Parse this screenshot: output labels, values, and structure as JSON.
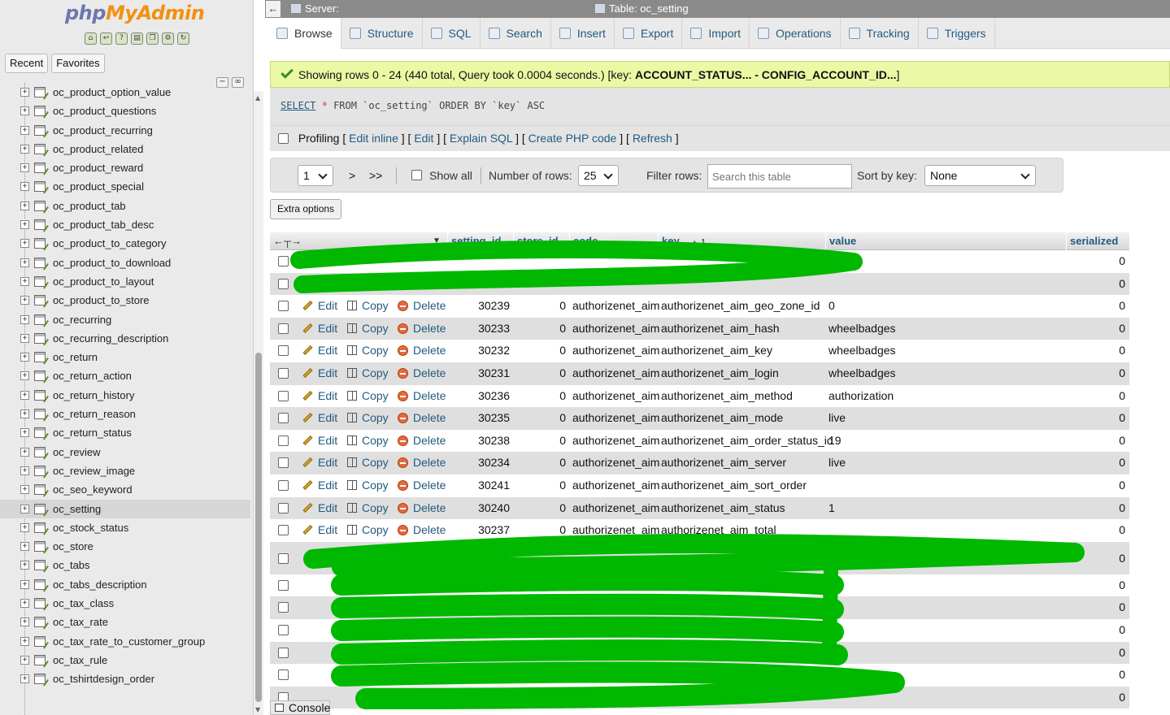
{
  "nav": {
    "logo_php": "php",
    "logo_myadmin": "MyAdmin",
    "recent_label": "Recent",
    "favorites_label": "Favorites",
    "tables": [
      "oc_product_option_value",
      "oc_product_questions",
      "oc_product_recurring",
      "oc_product_related",
      "oc_product_reward",
      "oc_product_special",
      "oc_product_tab",
      "oc_product_tab_desc",
      "oc_product_to_category",
      "oc_product_to_download",
      "oc_product_to_layout",
      "oc_product_to_store",
      "oc_recurring",
      "oc_recurring_description",
      "oc_return",
      "oc_return_action",
      "oc_return_history",
      "oc_return_reason",
      "oc_return_status",
      "oc_review",
      "oc_review_image",
      "oc_seo_keyword",
      "oc_setting",
      "oc_stock_status",
      "oc_store",
      "oc_tabs",
      "oc_tabs_description",
      "oc_tax_class",
      "oc_tax_rate",
      "oc_tax_rate_to_customer_group",
      "oc_tax_rule",
      "oc_tshirtdesign_order"
    ],
    "active_table": "oc_setting"
  },
  "topbar": {
    "server_label": "Server:",
    "table_label": "Table: oc_setting"
  },
  "tabs": [
    "Browse",
    "Structure",
    "SQL",
    "Search",
    "Insert",
    "Export",
    "Import",
    "Operations",
    "Tracking",
    "Triggers"
  ],
  "success": {
    "message_prefix": "Showing rows 0 - 24 (440 total, Query took 0.0004 seconds.) [key: ",
    "key_range": "ACCOUNT_STATUS... - CONFIG_ACCOUNT_ID...",
    "message_suffix": "]"
  },
  "sql": {
    "select": "SELECT",
    "star": "*",
    "rest": "FROM `oc_setting` ORDER BY `key` ASC"
  },
  "profiling": {
    "label": "Profiling",
    "links": [
      "Edit inline",
      "Edit",
      "Explain SQL",
      "Create PHP code",
      "Refresh"
    ]
  },
  "pager": {
    "page": "1",
    "next": ">",
    "last": ">>",
    "show_all": "Show all",
    "rows_label": "Number of rows:",
    "rows_value": "25",
    "filter_label": "Filter rows:",
    "filter_placeholder": "Search this table",
    "sort_label": "Sort by key:",
    "sort_value": "None"
  },
  "extra_options": "Extra options",
  "table": {
    "columns": [
      "setting_id",
      "store_id",
      "code",
      "key",
      "value",
      "serialized"
    ],
    "key_sort_marker": "1",
    "actions": {
      "edit": "Edit",
      "copy": "Copy",
      "delete": "Delete"
    },
    "rows": [
      {
        "setting_id": "",
        "store_id": "",
        "code": "",
        "key": "",
        "value": "",
        "serialized": "0",
        "redacted": true
      },
      {
        "setting_id": "",
        "store_id": "",
        "code": "",
        "key": "",
        "value": "",
        "serialized": "0",
        "redacted": true
      },
      {
        "setting_id": "30239",
        "store_id": "0",
        "code": "authorizenet_aim",
        "key": "authorizenet_aim_geo_zone_id",
        "value": "0",
        "serialized": "0"
      },
      {
        "setting_id": "30233",
        "store_id": "0",
        "code": "authorizenet_aim",
        "key": "authorizenet_aim_hash",
        "value": "wheelbadges",
        "serialized": "0"
      },
      {
        "setting_id": "30232",
        "store_id": "0",
        "code": "authorizenet_aim",
        "key": "authorizenet_aim_key",
        "value": "wheelbadges",
        "serialized": "0"
      },
      {
        "setting_id": "30231",
        "store_id": "0",
        "code": "authorizenet_aim",
        "key": "authorizenet_aim_login",
        "value": "wheelbadges",
        "serialized": "0"
      },
      {
        "setting_id": "30236",
        "store_id": "0",
        "code": "authorizenet_aim",
        "key": "authorizenet_aim_method",
        "value": "authorization",
        "serialized": "0"
      },
      {
        "setting_id": "30235",
        "store_id": "0",
        "code": "authorizenet_aim",
        "key": "authorizenet_aim_mode",
        "value": "live",
        "serialized": "0"
      },
      {
        "setting_id": "30238",
        "store_id": "0",
        "code": "authorizenet_aim",
        "key": "authorizenet_aim_order_status_id",
        "value": "19",
        "serialized": "0"
      },
      {
        "setting_id": "30234",
        "store_id": "0",
        "code": "authorizenet_aim",
        "key": "authorizenet_aim_server",
        "value": "live",
        "serialized": "0"
      },
      {
        "setting_id": "30241",
        "store_id": "0",
        "code": "authorizenet_aim",
        "key": "authorizenet_aim_sort_order",
        "value": "",
        "serialized": "0"
      },
      {
        "setting_id": "30240",
        "store_id": "0",
        "code": "authorizenet_aim",
        "key": "authorizenet_aim_status",
        "value": "1",
        "serialized": "0"
      },
      {
        "setting_id": "30237",
        "store_id": "0",
        "code": "authorizenet_aim",
        "key": "authorizenet_aim_total",
        "value": "",
        "serialized": "0"
      },
      {
        "setting_id": "",
        "store_id": "",
        "code": "",
        "key": "",
        "value": "",
        "serialized": "0",
        "redacted": true,
        "tall": true
      },
      {
        "setting_id": "",
        "store_id": "",
        "code": "",
        "key": "",
        "value": "",
        "serialized": "0",
        "redacted": true
      },
      {
        "setting_id": "",
        "store_id": "",
        "code": "",
        "key": "",
        "value": "",
        "serialized": "0",
        "redacted": true
      },
      {
        "setting_id": "",
        "store_id": "",
        "code": "",
        "key": "",
        "value": "",
        "serialized": "0",
        "redacted": true
      },
      {
        "setting_id": "",
        "store_id": "",
        "code": "",
        "key": "",
        "value": "",
        "serialized": "0",
        "redacted": true
      },
      {
        "setting_id": "",
        "store_id": "",
        "code": "",
        "key": "",
        "value": "",
        "serialized": "0",
        "redacted": true
      },
      {
        "setting_id": "",
        "store_id": "",
        "code": "",
        "key": "",
        "value": "",
        "serialized": "0",
        "redacted": true
      }
    ]
  },
  "console_label": "Console",
  "colors": {
    "link": "#235a81",
    "success_bg": "#ebf8a4",
    "redaction": "#00b800"
  }
}
